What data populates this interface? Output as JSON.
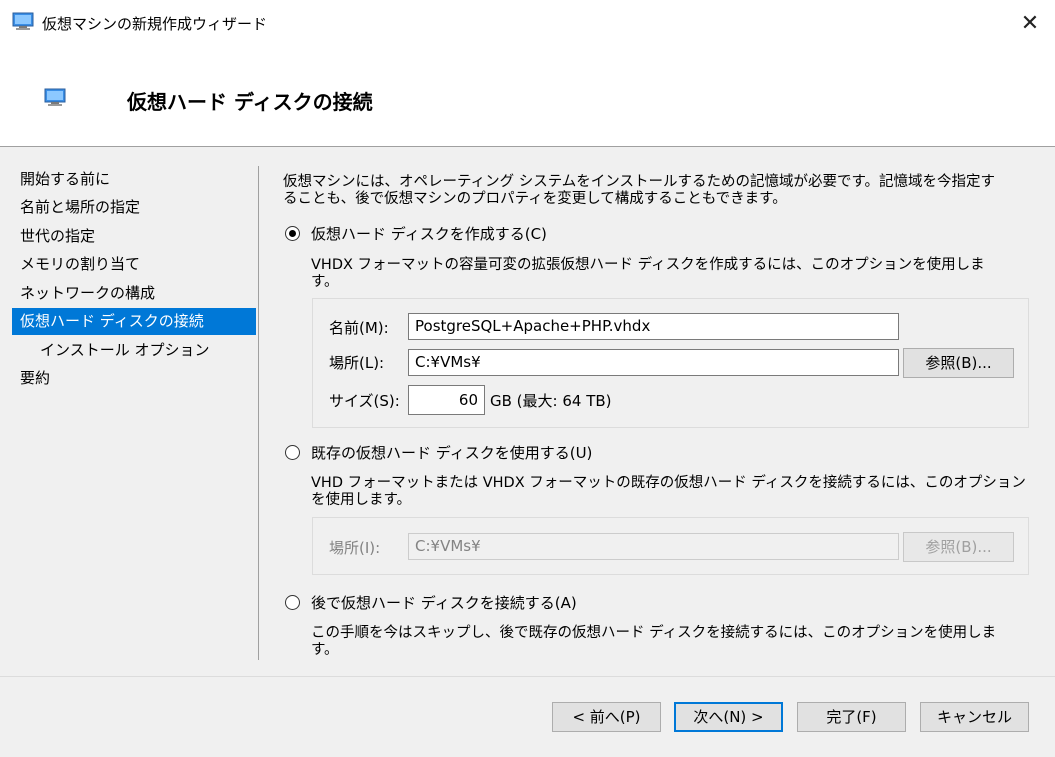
{
  "window": {
    "title": "仮想マシンの新規作成ウィザード",
    "close_glyph": "✕"
  },
  "header": {
    "title": "仮想ハード ディスクの接続"
  },
  "nav": {
    "items": [
      {
        "label": "開始する前に"
      },
      {
        "label": "名前と場所の指定"
      },
      {
        "label": "世代の指定"
      },
      {
        "label": "メモリの割り当て"
      },
      {
        "label": "ネットワークの構成"
      },
      {
        "label": "仮想ハード ディスクの接続",
        "active": true
      },
      {
        "label": "インストール オプション"
      },
      {
        "label": "要約"
      }
    ]
  },
  "main": {
    "intro_line1": "仮想マシンには、オペレーティング システムをインストールするための記憶域が必要です。記憶域を今指定す",
    "intro_line2": "ることも、後で仮想マシンのプロパティを変更して構成することもできます。",
    "create": {
      "label": "仮想ハード ディスクを作成する(C)",
      "selected": true,
      "desc_line1": "VHDX フォーマットの容量可変の拡張仮想ハード ディスクを作成するには、このオプションを使用しま",
      "desc_line2": "す。",
      "name_label": "名前(M):",
      "name_value": "PostgreSQL+Apache+PHP.vhdx",
      "location_label": "場所(L):",
      "location_value": "C:¥VMs¥",
      "browse_label": "参照(B)...",
      "size_label": "サイズ(S):",
      "size_value": "60",
      "size_unit": "GB (最大: 64 TB)"
    },
    "existing": {
      "label": "既存の仮想ハード ディスクを使用する(U)",
      "selected": false,
      "desc_line1": "VHD フォーマットまたは VHDX フォーマットの既存の仮想ハード ディスクを接続するには、このオプション",
      "desc_line2": "を使用します。",
      "location_label": "場所(I):",
      "location_value": "C:¥VMs¥",
      "browse_label": "参照(B)..."
    },
    "later": {
      "label": "後で仮想ハード ディスクを接続する(A)",
      "selected": false,
      "desc_line1": "この手順を今はスキップし、後で既存の仮想ハード ディスクを接続するには、このオプションを使用しま",
      "desc_line2": "す。"
    }
  },
  "footer": {
    "prev_label": "< 前へ(P)",
    "next_label": "次へ(N) >",
    "finish_label": "完了(F)",
    "cancel_label": "キャンセル"
  },
  "colors": {
    "accent": "#0078d7",
    "window_bg": "#f0f0f0",
    "header_bg": "#ffffff"
  }
}
